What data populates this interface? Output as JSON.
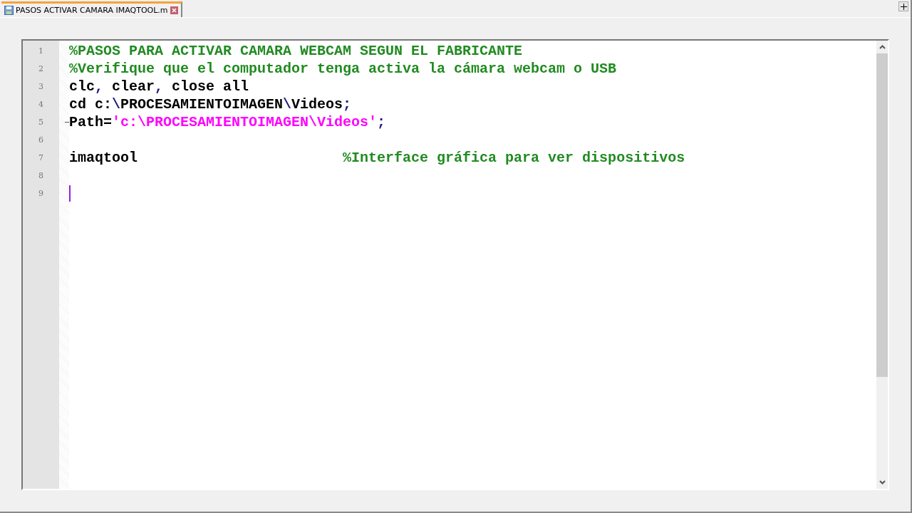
{
  "tabs": [
    {
      "label": "PASOS ACTIVAR CAMARA IMAQTOOL.m",
      "selected": true
    }
  ],
  "editor": {
    "lines": [
      {
        "number": "1",
        "folded": false,
        "tokens": [
          {
            "kind": "comment",
            "text": "%PASOS PARA ACTIVAR CAMARA WEBCAM SEGUN EL FABRICANTE"
          }
        ]
      },
      {
        "number": "2",
        "folded": false,
        "tokens": [
          {
            "kind": "comment",
            "text": "%Verifique que el computador tenga activa la cámara webcam o USB"
          }
        ]
      },
      {
        "number": "3",
        "folded": false,
        "tokens": [
          {
            "kind": "code",
            "text": "clc"
          },
          {
            "kind": "operator",
            "text": ","
          },
          {
            "kind": "code",
            "text": " clear"
          },
          {
            "kind": "operator",
            "text": ","
          },
          {
            "kind": "code",
            "text": " close all"
          }
        ]
      },
      {
        "number": "4",
        "folded": false,
        "tokens": [
          {
            "kind": "code",
            "text": "cd c:"
          },
          {
            "kind": "operator",
            "text": "\\"
          },
          {
            "kind": "code",
            "text": "PROCESAMIENTOIMAGEN"
          },
          {
            "kind": "operator",
            "text": "\\"
          },
          {
            "kind": "code",
            "text": "Videos"
          },
          {
            "kind": "operator",
            "text": ";"
          }
        ]
      },
      {
        "number": "5",
        "folded": true,
        "tokens": [
          {
            "kind": "code",
            "text": "Path"
          },
          {
            "kind": "code",
            "text": "="
          },
          {
            "kind": "string",
            "text": "'c:\\PROCESAMIENTOIMAGEN\\Videos'"
          },
          {
            "kind": "operator",
            "text": ";"
          }
        ]
      },
      {
        "number": "6",
        "folded": false
      },
      {
        "number": "7",
        "folded": false,
        "tokens": [
          {
            "kind": "code",
            "text": "imaqtool                        "
          },
          {
            "kind": "comment",
            "text": "%Interface gráfica para ver dispositivos"
          }
        ]
      },
      {
        "number": "8",
        "folded": false
      },
      {
        "number": "9",
        "folded": false,
        "caret": true
      }
    ]
  }
}
